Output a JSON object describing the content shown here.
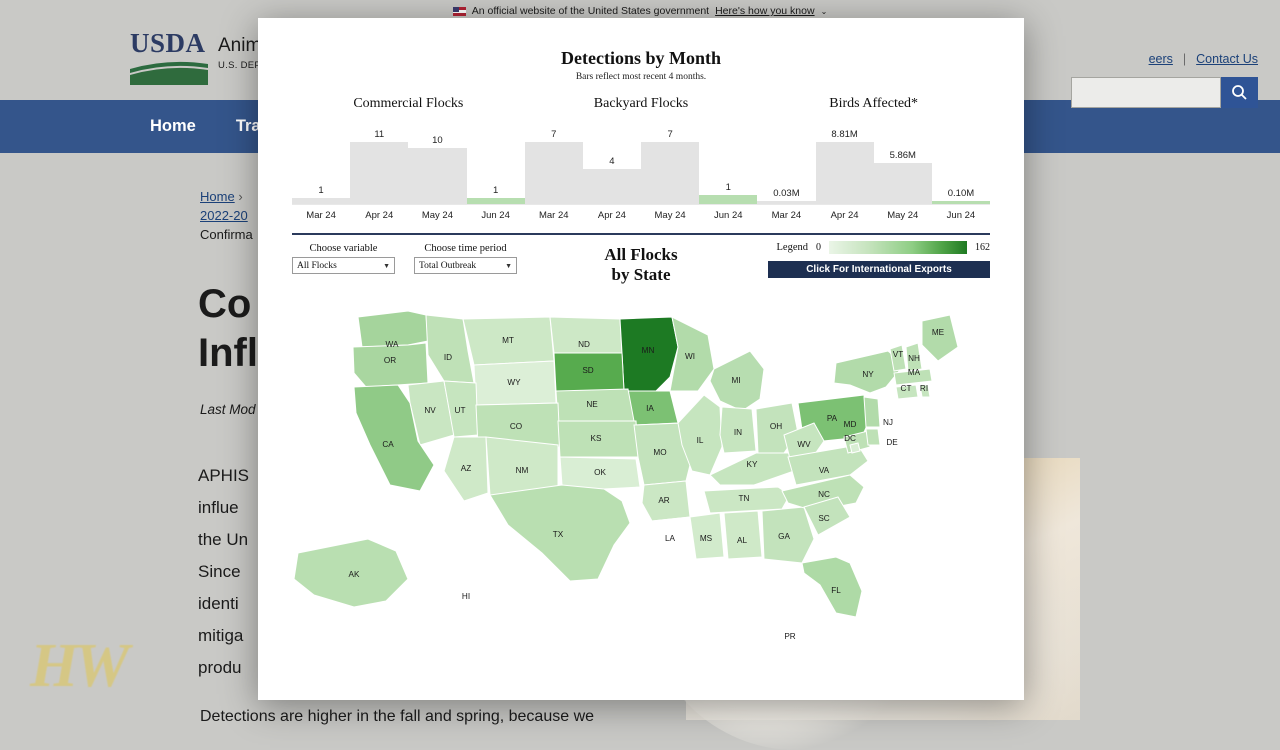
{
  "gov_banner": {
    "text": "An official website of the United States government",
    "link": "Here's how you know",
    "caret": "⌄"
  },
  "site_header": {
    "logo_word": "USDA",
    "agency_line1": "Animal",
    "agency_line2": "U.S. DEPA",
    "util_links": [
      "eers",
      "Contact Us"
    ],
    "util_separator": "|",
    "search_placeholder": "",
    "search_icon": "search-icon"
  },
  "nav": {
    "items": [
      "Home",
      "Tra"
    ]
  },
  "breadcrumb": {
    "items": [
      "Home",
      "2022-20",
      "Confirma"
    ],
    "separator": "›"
  },
  "page": {
    "title_line1": "Co",
    "title_line2": "Infl",
    "last_modified": "Last Mod",
    "paragraph_lines": [
      "APHIS",
      "influe",
      "the Un",
      "Since",
      "identi",
      "mitiga",
      "produ"
    ],
    "paragraph_2": "Detections are higher in the fall and spring, because we",
    "watermark": "HW"
  },
  "dashboard": {
    "title": "Detections by Month",
    "subtitle": "Bars reflect most recent 4 months.",
    "controls": {
      "variable_label": "Choose variable",
      "variable_value": "All Flocks",
      "period_label": "Choose time period",
      "period_value": "Total Outbreak",
      "caret": "▼"
    },
    "map_title_line1": "All Flocks",
    "map_title_line2": "by State",
    "legend": {
      "label": "Legend",
      "min": "0",
      "max": "162"
    },
    "export_button": "Click For International Exports"
  },
  "chart_data": [
    {
      "type": "bar",
      "title": "Commercial Flocks",
      "categories": [
        "Mar 24",
        "Apr 24",
        "May 24",
        "Jun 24"
      ],
      "values": [
        1,
        11,
        10,
        1
      ],
      "labels": [
        "1",
        "11",
        "10",
        "1"
      ],
      "highlight_index": 3,
      "ylim": [
        0,
        11
      ],
      "xlabel": "",
      "ylabel": ""
    },
    {
      "type": "bar",
      "title": "Backyard Flocks",
      "categories": [
        "Mar 24",
        "Apr 24",
        "May 24",
        "Jun 24"
      ],
      "values": [
        7,
        4,
        7,
        1
      ],
      "labels": [
        "7",
        "4",
        "7",
        "1"
      ],
      "highlight_index": 3,
      "ylim": [
        0,
        7
      ],
      "xlabel": "",
      "ylabel": ""
    },
    {
      "type": "bar",
      "title": "Birds Affected*",
      "categories": [
        "Mar 24",
        "Apr 24",
        "May 24",
        "Jun 24"
      ],
      "values": [
        0.03,
        8.81,
        5.86,
        0.1
      ],
      "labels": [
        "0.03M",
        "8.81M",
        "5.86M",
        "0.10M"
      ],
      "highlight_index": 3,
      "ylim": [
        0,
        8.81
      ],
      "xlabel": "",
      "ylabel": ""
    }
  ],
  "map_data": {
    "type": "choropleth",
    "title": "All Flocks by State",
    "value_range": [
      0,
      162
    ],
    "states": [
      {
        "code": "WA",
        "shade": "#a5d49c"
      },
      {
        "code": "OR",
        "shade": "#a9d6a0"
      },
      {
        "code": "ID",
        "shade": "#bfe1b7"
      },
      {
        "code": "MT",
        "shade": "#cde8c6"
      },
      {
        "code": "ND",
        "shade": "#cde8c6"
      },
      {
        "code": "MN",
        "shade": "#1d7a23"
      },
      {
        "code": "SD",
        "shade": "#57ab4e"
      },
      {
        "code": "WI",
        "shade": "#b2dbaa"
      },
      {
        "code": "MI",
        "shade": "#b7ddb0"
      },
      {
        "code": "IA",
        "shade": "#7cc173"
      },
      {
        "code": "NE",
        "shade": "#bee1b6"
      },
      {
        "code": "WY",
        "shade": "#dcefd7"
      },
      {
        "code": "NV",
        "shade": "#c9e6c2"
      },
      {
        "code": "UT",
        "shade": "#c6e5bf"
      },
      {
        "code": "CO",
        "shade": "#bee1b6"
      },
      {
        "code": "KS",
        "shade": "#bee1b6"
      },
      {
        "code": "CA",
        "shade": "#90ca87"
      },
      {
        "code": "AZ",
        "shade": "#cfe9c8"
      },
      {
        "code": "NM",
        "shade": "#cfe9c8"
      },
      {
        "code": "OK",
        "shade": "#d9eed4"
      },
      {
        "code": "TX",
        "shade": "#b9dfb1"
      },
      {
        "code": "MO",
        "shade": "#c3e3bc"
      },
      {
        "code": "AR",
        "shade": "#cbe7c4"
      },
      {
        "code": "LA",
        "shade": "#ffffff"
      },
      {
        "code": "MS",
        "shade": "#d2ebcc"
      },
      {
        "code": "AL",
        "shade": "#cfe9c8"
      },
      {
        "code": "GA",
        "shade": "#c3e3bc"
      },
      {
        "code": "FL",
        "shade": "#aedaa6"
      },
      {
        "code": "TN",
        "shade": "#cbe7c4"
      },
      {
        "code": "KY",
        "shade": "#c6e5bf"
      },
      {
        "code": "IL",
        "shade": "#c6e5bf"
      },
      {
        "code": "IN",
        "shade": "#c6e5bf"
      },
      {
        "code": "OH",
        "shade": "#c3e3bc"
      },
      {
        "code": "PA",
        "shade": "#7cc173"
      },
      {
        "code": "NY",
        "shade": "#b2dbaa"
      },
      {
        "code": "WV",
        "shade": "#c6e5bf"
      },
      {
        "code": "VA",
        "shade": "#c3e3bc"
      },
      {
        "code": "NC",
        "shade": "#bee1b6"
      },
      {
        "code": "SC",
        "shade": "#c3e3bc"
      },
      {
        "code": "MD",
        "shade": "#bee1b6"
      },
      {
        "code": "DC",
        "shade": "#d9eed4"
      },
      {
        "code": "DE",
        "shade": "#bee1b6"
      },
      {
        "code": "NJ",
        "shade": "#b2dbaa"
      },
      {
        "code": "CT",
        "shade": "#c6e5bf"
      },
      {
        "code": "RI",
        "shade": "#c6e5bf"
      },
      {
        "code": "MA",
        "shade": "#bee1b6"
      },
      {
        "code": "VT",
        "shade": "#bee1b6"
      },
      {
        "code": "NH",
        "shade": "#bee1b6"
      },
      {
        "code": "ME",
        "shade": "#b2dbaa"
      },
      {
        "code": "AK",
        "shade": "#b9dfb1"
      },
      {
        "code": "HI",
        "shade": "#ffffff"
      },
      {
        "code": "PR",
        "shade": "#ffffff"
      }
    ]
  }
}
